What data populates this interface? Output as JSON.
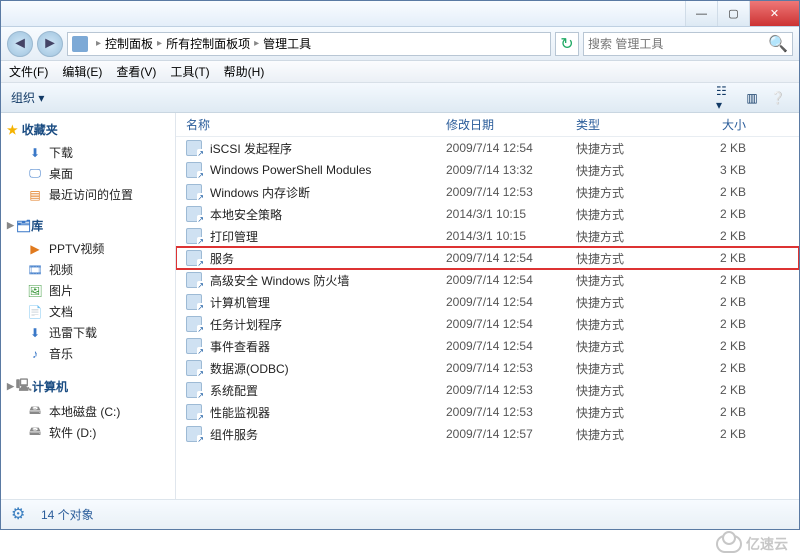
{
  "titlebar": {
    "min": "—",
    "max": "▢",
    "close": "✕"
  },
  "breadcrumb": {
    "items": [
      "控制面板",
      "所有控制面板项",
      "管理工具"
    ]
  },
  "search": {
    "placeholder": "搜索 管理工具"
  },
  "menu": {
    "file": "文件(F)",
    "edit": "编辑(E)",
    "view": "查看(V)",
    "tools": "工具(T)",
    "help": "帮助(H)"
  },
  "toolbar": {
    "organize": "组织 ▾"
  },
  "sidebar": {
    "favorites": {
      "title": "收藏夹",
      "items": [
        "下载",
        "桌面",
        "最近访问的位置"
      ]
    },
    "libraries": {
      "title": "库",
      "items": [
        "PPTV视频",
        "视频",
        "图片",
        "文档",
        "迅雷下载",
        "音乐"
      ]
    },
    "computer": {
      "title": "计算机",
      "items": [
        "本地磁盘 (C:)",
        "软件 (D:)"
      ]
    }
  },
  "columns": {
    "name": "名称",
    "date": "修改日期",
    "type": "类型",
    "size": "大小"
  },
  "files": [
    {
      "name": "iSCSI 发起程序",
      "date": "2009/7/14 12:54",
      "type": "快捷方式",
      "size": "2 KB"
    },
    {
      "name": "Windows PowerShell Modules",
      "date": "2009/7/14 13:32",
      "type": "快捷方式",
      "size": "3 KB"
    },
    {
      "name": "Windows 内存诊断",
      "date": "2009/7/14 12:53",
      "type": "快捷方式",
      "size": "2 KB"
    },
    {
      "name": "本地安全策略",
      "date": "2014/3/1 10:15",
      "type": "快捷方式",
      "size": "2 KB"
    },
    {
      "name": "打印管理",
      "date": "2014/3/1 10:15",
      "type": "快捷方式",
      "size": "2 KB"
    },
    {
      "name": "服务",
      "date": "2009/7/14 12:54",
      "type": "快捷方式",
      "size": "2 KB",
      "highlight": true
    },
    {
      "name": "高级安全 Windows 防火墙",
      "date": "2009/7/14 12:54",
      "type": "快捷方式",
      "size": "2 KB"
    },
    {
      "name": "计算机管理",
      "date": "2009/7/14 12:54",
      "type": "快捷方式",
      "size": "2 KB"
    },
    {
      "name": "任务计划程序",
      "date": "2009/7/14 12:54",
      "type": "快捷方式",
      "size": "2 KB"
    },
    {
      "name": "事件查看器",
      "date": "2009/7/14 12:54",
      "type": "快捷方式",
      "size": "2 KB"
    },
    {
      "name": "数据源(ODBC)",
      "date": "2009/7/14 12:53",
      "type": "快捷方式",
      "size": "2 KB"
    },
    {
      "name": "系统配置",
      "date": "2009/7/14 12:53",
      "type": "快捷方式",
      "size": "2 KB"
    },
    {
      "name": "性能监视器",
      "date": "2009/7/14 12:53",
      "type": "快捷方式",
      "size": "2 KB"
    },
    {
      "name": "组件服务",
      "date": "2009/7/14 12:57",
      "type": "快捷方式",
      "size": "2 KB"
    }
  ],
  "status": {
    "count": "14 个对象"
  },
  "watermark": "亿速云"
}
